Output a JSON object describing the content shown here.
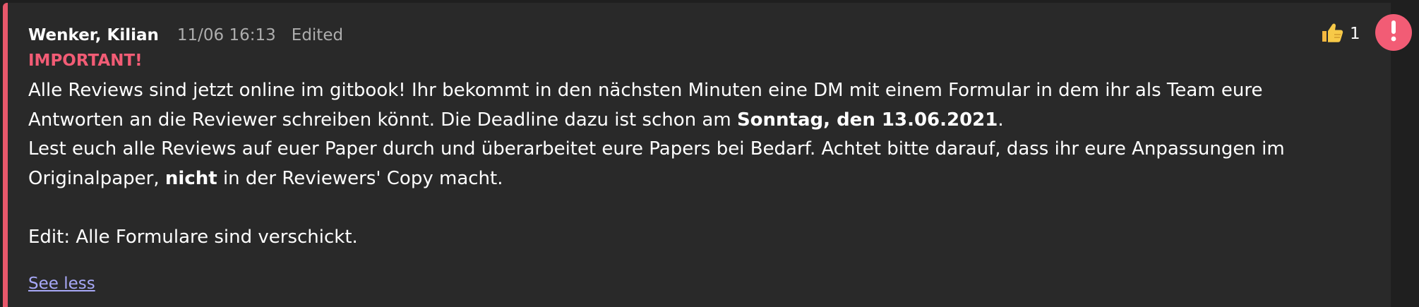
{
  "message": {
    "author": "Wenker, Kilian",
    "timestamp": "11/06 16:13",
    "edited_label": "Edited",
    "importance_label": "IMPORTANT!",
    "body": {
      "l1": "Alle Reviews sind jetzt online im gitbook! Ihr bekommt in den nächsten Minuten eine DM mit einem Formular in dem ihr als Team eure",
      "l2_a": "Antworten an die Reviewer schreiben könnt. Die Deadline dazu ist schon am ",
      "l2_b": "Sonntag, den 13.06.2021",
      "l2_c": ".",
      "l3": "Lest euch alle Reviews auf euer Paper durch und überarbeitet eure Papers bei Bedarf. Achtet bitte darauf, dass ihr eure Anpassungen im",
      "l4_a": "Originalpaper, ",
      "l4_b": "nicht",
      "l4_c": " in der Reviewers' Copy macht.",
      "l5": "Edit: Alle Formulare sind verschickt."
    },
    "see_less_label": "See less",
    "reactions": [
      {
        "icon": "thumbs-up-icon",
        "count": "1"
      }
    ],
    "urgent_icon": "exclamation-icon",
    "colors": {
      "accent": "#e8586b",
      "important": "#f25c75",
      "link": "#a7a8f6",
      "background": "#292929"
    }
  }
}
